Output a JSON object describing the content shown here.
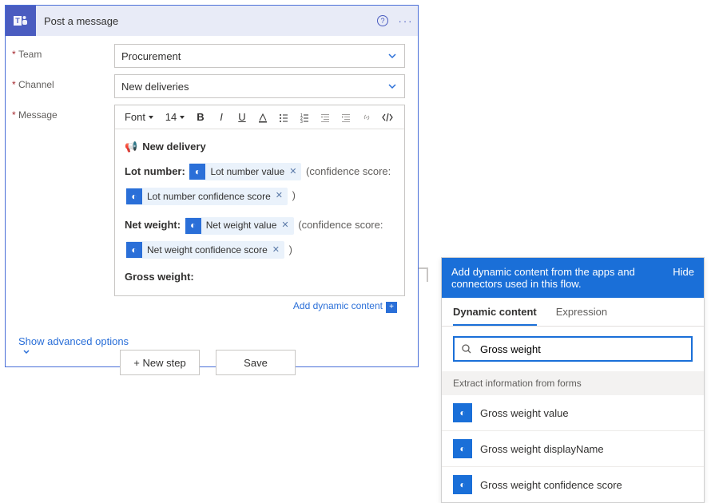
{
  "card": {
    "title": "Post a message",
    "help_icon": "?",
    "more_icon": "···",
    "fields": {
      "team_label": "Team",
      "team_value": "Procurement",
      "channel_label": "Channel",
      "channel_value": "New deliveries",
      "message_label": "Message"
    },
    "toolbar": {
      "font": "Font",
      "size": "14"
    },
    "message": {
      "title": "New delivery",
      "lot_label": "Lot number:",
      "net_label": "Net weight:",
      "gross_label": "Gross weight:",
      "conf_open": "(confidence score:",
      "conf_close": ")",
      "tokens": {
        "lot_value": "Lot number value",
        "lot_conf": "Lot number confidence score",
        "net_value": "Net weight value",
        "net_conf": "Net weight confidence score"
      }
    },
    "add_dynamic": "Add dynamic content",
    "show_advanced": "Show advanced options"
  },
  "footer": {
    "new_step": "+ New step",
    "save": "Save"
  },
  "panel": {
    "header": "Add dynamic content from the apps and connectors used in this flow.",
    "hide": "Hide",
    "tabs": {
      "dynamic": "Dynamic content",
      "expression": "Expression"
    },
    "search_value": "Gross weight",
    "category": "Extract information from forms",
    "items": [
      "Gross weight value",
      "Gross weight displayName",
      "Gross weight confidence score"
    ]
  }
}
